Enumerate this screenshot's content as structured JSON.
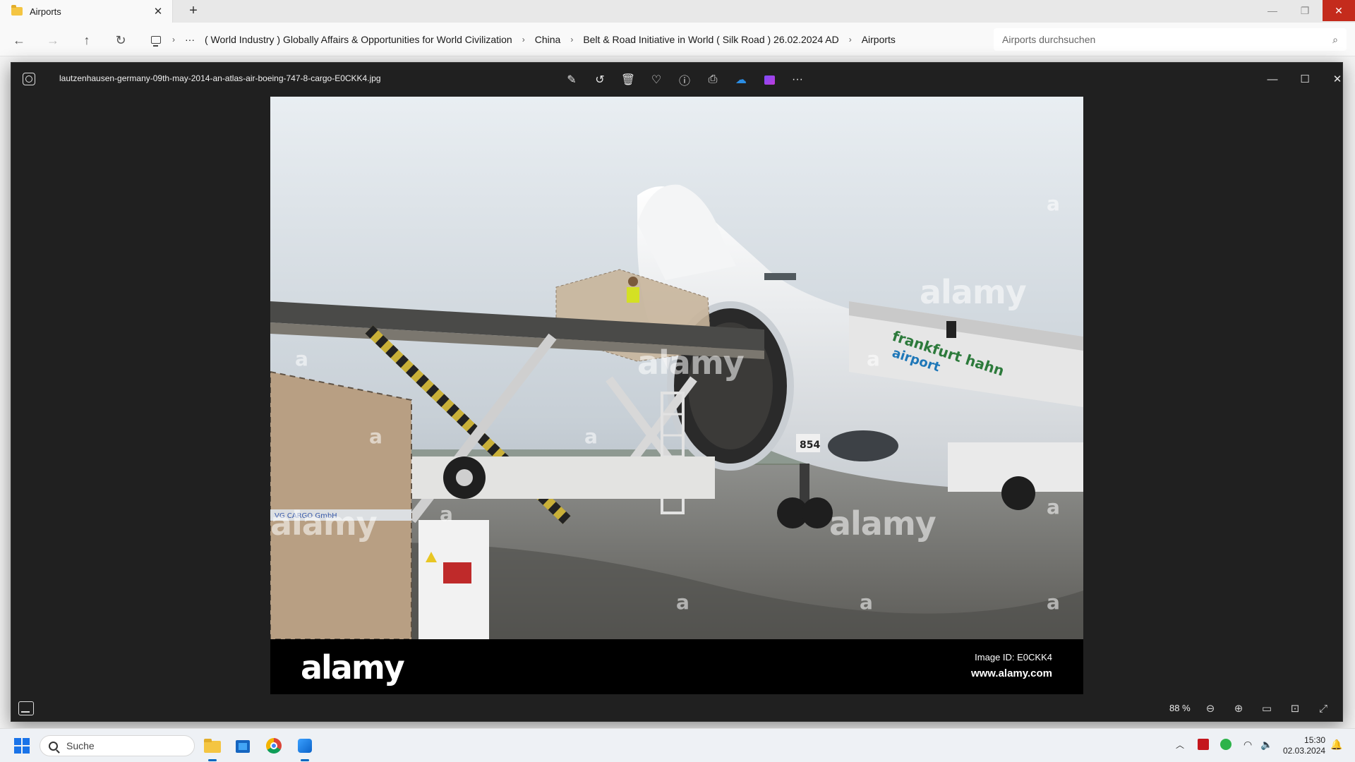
{
  "explorer": {
    "tab_title": "Airports",
    "breadcrumbs": [
      "( World Industry ) Globally Affairs & Opportunities for World Civilization",
      "China",
      "Belt & Road Initiative in World ( Silk Road ) 26.02.2024 AD",
      "Airports"
    ],
    "search_placeholder": "Airports durchsuchen"
  },
  "viewer": {
    "filename": "lautzenhausen-germany-09th-may-2014-an-atlas-air-boeing-747-8-cargo-E0CKK4.jpg",
    "zoom_label": "88 %",
    "photo": {
      "watermark": "alamy",
      "watermark_small": "a",
      "stair_text_1": "frankfurt hahn",
      "stair_text_2": "airport",
      "crate_text": "VG CARGO GmbH",
      "gear_number": "854",
      "footer_brand": "alamy",
      "image_id": "Image ID: E0CKK4",
      "site": "www.alamy.com"
    }
  },
  "taskbar": {
    "search_label": "Suche",
    "time": "15:30",
    "date": "02.03.2024"
  },
  "colors": {
    "viewer_bg": "#202020",
    "close_red": "#c42b1c",
    "accent": "#0067c0"
  }
}
